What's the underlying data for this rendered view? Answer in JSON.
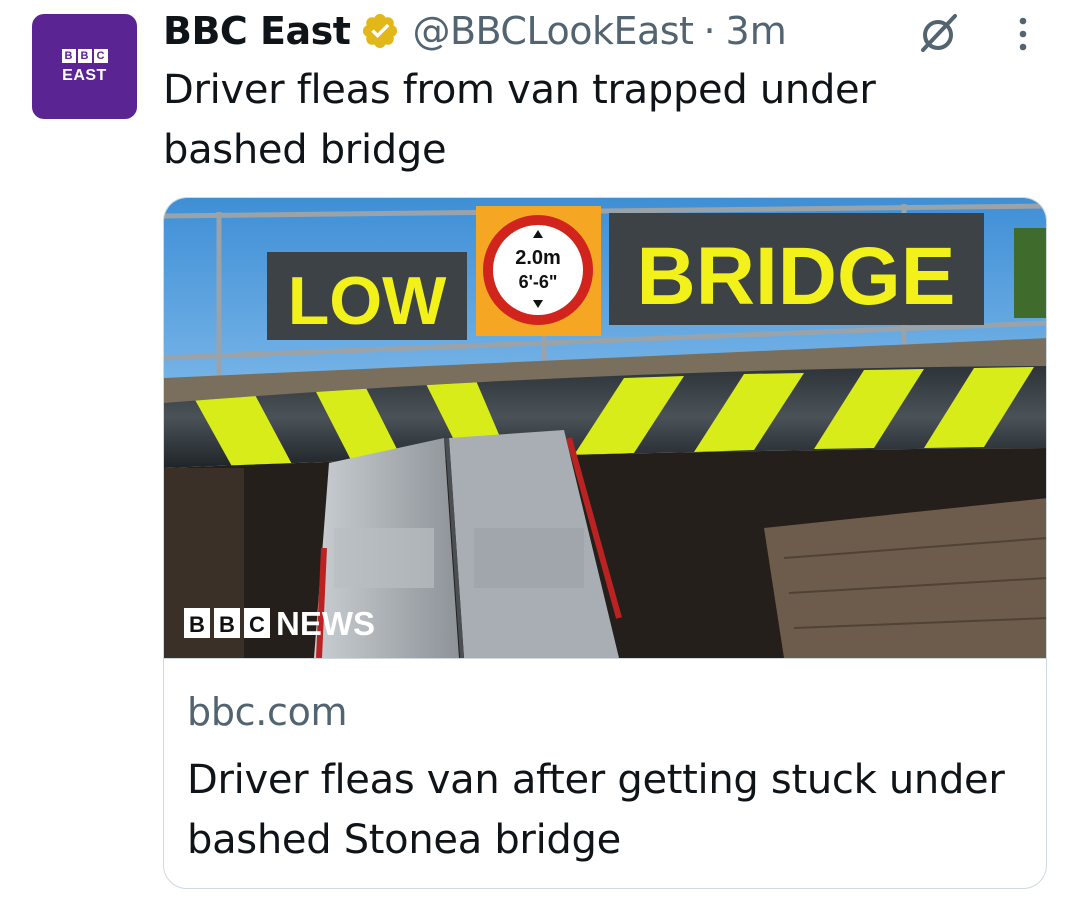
{
  "author": {
    "avatar_label": "EAST",
    "avatar_blocks": [
      "B",
      "B",
      "C"
    ],
    "display_name": "BBC East",
    "verified_icon": "verified-badge-icon",
    "handle": "@BBCLookEast",
    "separator": "·",
    "time": "3m"
  },
  "tweet": {
    "text": "Driver fleas from van trapped under bashed bridge"
  },
  "actions": {
    "translate_icon": "grok-translate-icon",
    "more_icon": "more-vertical-icon"
  },
  "card": {
    "image": {
      "sign_left": "LOW",
      "sign_right": "BRIDGE",
      "limit_metric": "2.0m",
      "limit_imperial": "6'-6\"",
      "watermark_blocks": [
        "B",
        "B",
        "C"
      ],
      "watermark_text": "NEWS"
    },
    "domain": "bbc.com",
    "title": "Driver fleas van after getting stuck under bashed Stonea bridge"
  },
  "colors": {
    "brand_purple": "#5a2592",
    "verified_gold": "#e2b719",
    "secondary_text": "#536471",
    "border": "#cfd9de"
  }
}
